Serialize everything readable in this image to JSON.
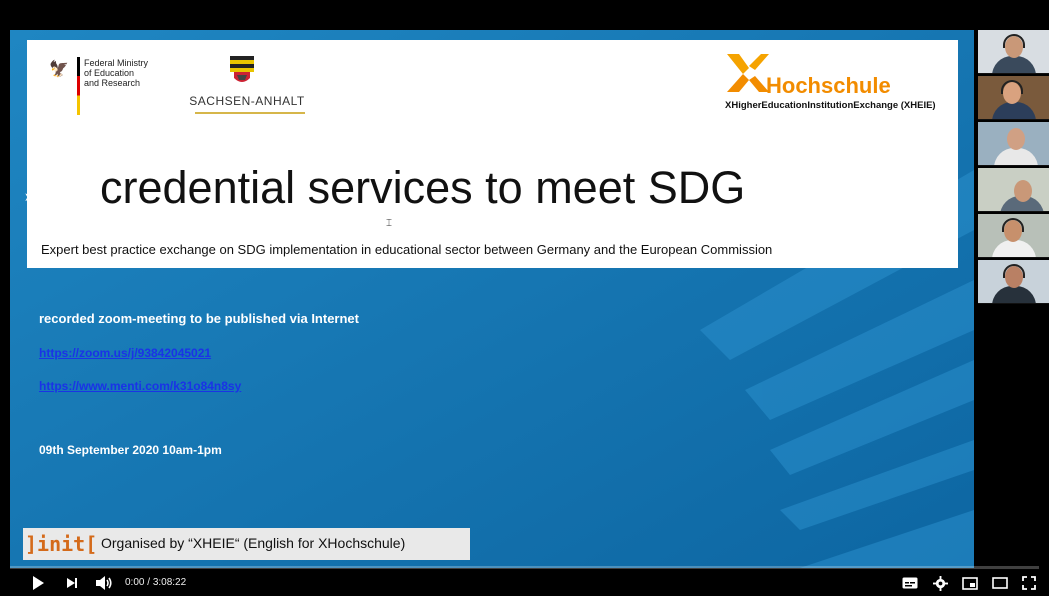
{
  "slide": {
    "bmbf_text": "Federal Ministry\nof Education\nand Research",
    "sachsen_text": "SACHSEN-ANHALT",
    "xh_title": "Hochschule",
    "xh_subtitle": "XHigherEducationInstitutionExchange (XHEIE)",
    "title": "credential services to meet SDG",
    "subtitle": "Expert best practice exchange on SDG implementation in educational sector between Germany and the European Commission",
    "meeting_note": "recorded zoom-meeting to be published via Internet",
    "zoom_link": "https://zoom.us/j/93842045021",
    "menti_link": "https://www.menti.com/k31o84n8sy",
    "date": "09th September 2020 10am-1pm",
    "organiser_logo": "]init[",
    "organiser_text": "Organised by “XHEIE“ (English for XHochschule)"
  },
  "player": {
    "current_time": "0:00",
    "separator": " / ",
    "duration": "3:08:22",
    "icons": [
      "play-icon",
      "next-icon",
      "volume-icon",
      "subtitles-icon",
      "settings-icon",
      "miniplayer-icon",
      "theater-icon",
      "fullscreen-icon"
    ]
  },
  "colors": {
    "slide_blue": "#1478b4",
    "brand_orange": "#f28c00",
    "link_blue": "#1a33e6"
  }
}
